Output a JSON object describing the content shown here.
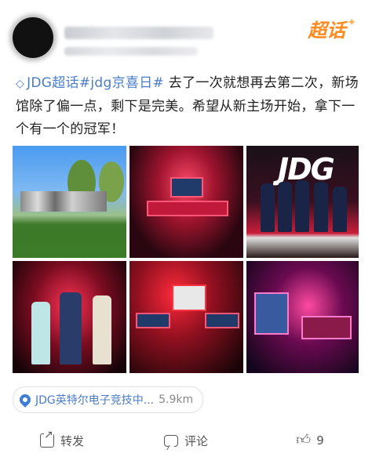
{
  "post": {
    "badge_label": "超话",
    "topic_icon": "diamond-icon",
    "topic_text": "JDG超话#jdg京喜日#",
    "body": " 去了一次就想再去第二次，新场馆除了偏一点，剩下是完美。希望从新主场开始，拿下一个有一个的冠军！"
  },
  "location": {
    "icon": "location-pin-icon",
    "name": "JDG英特尔电子竞技中...",
    "distance": "5.9km"
  },
  "actions": {
    "share_label": "转发",
    "comment_label": "评论",
    "like_count": "9"
  },
  "colors": {
    "topic_blue": "#4a7dc7",
    "badge_orange": "#ff8a1f"
  }
}
